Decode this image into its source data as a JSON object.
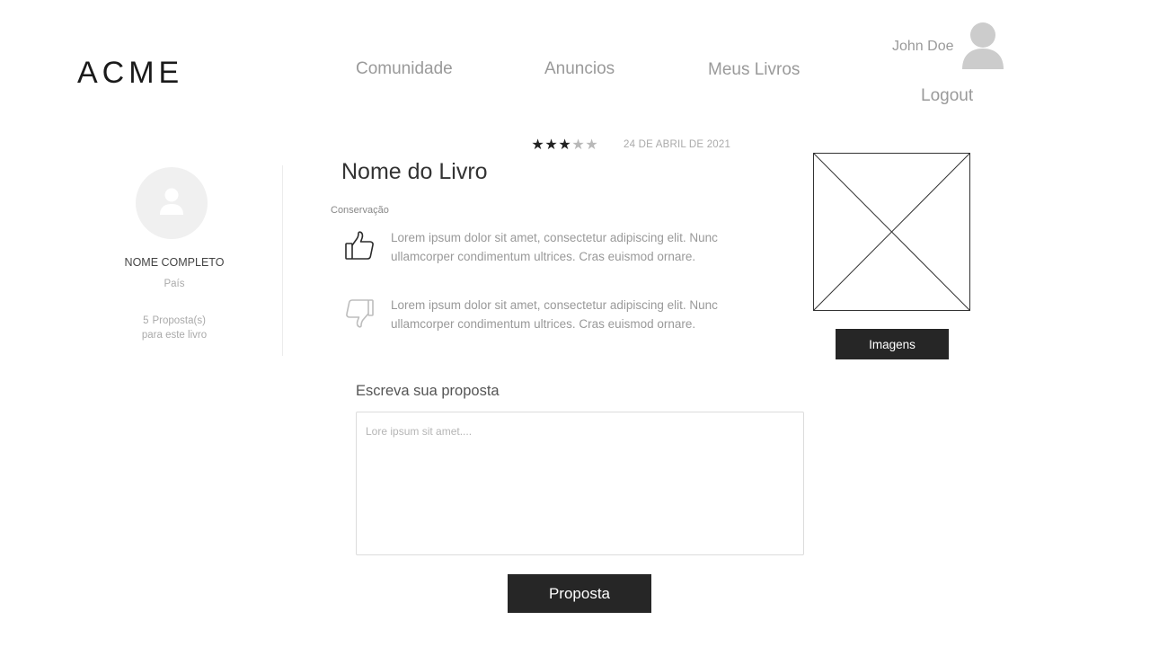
{
  "header": {
    "logo": "ACME",
    "nav": {
      "comunidade": "Comunidade",
      "anuncios": "Anuncios",
      "meus_livros": "Meus Livros"
    },
    "user": {
      "name": "John Doe",
      "logout": "Logout",
      "avatar_icon": "user-avatar-icon"
    }
  },
  "profile": {
    "name": "NOME COMPLETO",
    "country": "País",
    "proposals_count": "5",
    "proposals_label": "Proposta(s)",
    "proposals_sub": "para este livro",
    "avatar_icon": "user-icon"
  },
  "book": {
    "rating": 3,
    "rating_max": 5,
    "date": "24 DE ABRIL DE 2021",
    "title": "Nome do Livro",
    "condition_label": "Conservação",
    "positive": "Lorem ipsum dolor sit amet, consectetur adipiscing elit. Nunc ullamcorper condimentum ultrices. Cras euismod ornare.",
    "negative": "Lorem ipsum dolor sit amet, consectetur adipiscing elit. Nunc ullamcorper condimentum ultrices. Cras euismod ornare.",
    "positive_icon": "thumbs-up-icon",
    "negative_icon": "thumbs-down-icon",
    "images_button": "Imagens"
  },
  "proposal": {
    "label": "Escreva sua proposta",
    "placeholder": "Lore ipsum sit amet....",
    "value": "",
    "submit": "Proposta"
  },
  "colors": {
    "dark_button": "#262626",
    "muted_text": "#9a9a9a",
    "avatar_bg": "#f0f0f0"
  }
}
